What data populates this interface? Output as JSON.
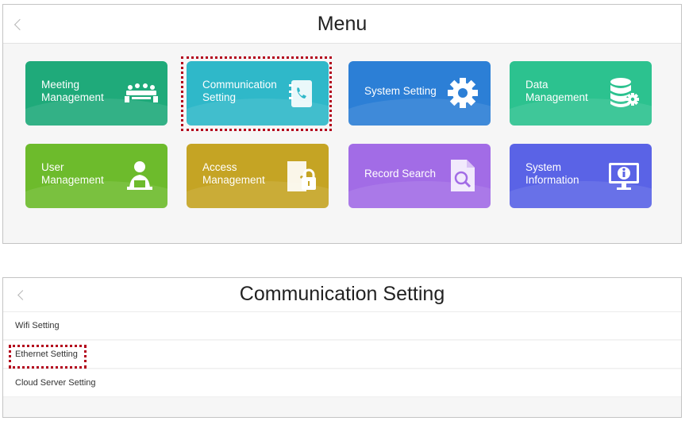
{
  "menu_screen": {
    "title": "Menu",
    "tiles": [
      {
        "line1": "Meeting",
        "line2": "Management",
        "icon": "meeting-icon",
        "color": "#1faa7a"
      },
      {
        "line1": "Communication",
        "line2": "Setting",
        "icon": "phone-book-icon",
        "color": "#2fb8c9",
        "highlighted": true
      },
      {
        "line1": "System Setting",
        "line2": "",
        "icon": "gear-icon",
        "color": "#2c7fd6"
      },
      {
        "line1": "Data",
        "line2": "Management",
        "icon": "database-gear-icon",
        "color": "#2cc28f"
      },
      {
        "line1": "User",
        "line2": "Management",
        "icon": "user-icon",
        "color": "#6dbb2c"
      },
      {
        "line1": "Access",
        "line2": "Management",
        "icon": "door-lock-icon",
        "color": "#c5a424"
      },
      {
        "line1": "Record Search",
        "line2": "",
        "icon": "document-search-icon",
        "color": "#a26ce6"
      },
      {
        "line1": "System",
        "line2": "Information",
        "icon": "monitor-info-icon",
        "color": "#5a63e6"
      }
    ]
  },
  "comm_screen": {
    "title": "Communication Setting",
    "items": [
      {
        "label": "Wifi Setting"
      },
      {
        "label": "Ethernet Setting",
        "highlighted": true
      },
      {
        "label": "Cloud Server Setting"
      }
    ]
  },
  "colors": {
    "highlight": "#b3001b"
  }
}
